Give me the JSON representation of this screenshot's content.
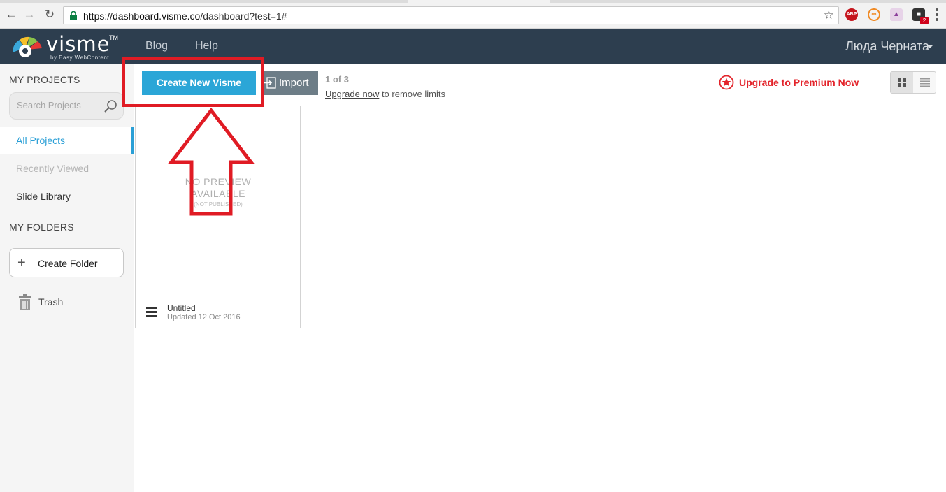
{
  "browser": {
    "url_host": "https://dashboard.visme.co",
    "url_path": "/dashboard?test=1#",
    "ext_abp_label": "ABP",
    "ext_badge": "2"
  },
  "header": {
    "logo_word": "visme",
    "logo_tm": "TM",
    "logo_sub": "by Easy WebContent",
    "links": [
      "Blog",
      "Help"
    ],
    "user_name": "Люда Черната"
  },
  "sidebar": {
    "projects_title": "MY PROJECTS",
    "search_placeholder": "Search Projects",
    "nav": [
      {
        "label": "All Projects",
        "state": "active"
      },
      {
        "label": "Recently Viewed",
        "state": "disabled"
      },
      {
        "label": "Slide Library",
        "state": "normal"
      }
    ],
    "folders_title": "MY FOLDERS",
    "create_folder_label": "Create Folder",
    "trash_label": "Trash"
  },
  "toolbar": {
    "create_label": "Create New Visme",
    "import_label": "Import",
    "quota_text": "1 of 3",
    "upgrade_link": "Upgrade now",
    "upgrade_rest": " to remove limits",
    "premium_label": "Upgrade to Premium Now"
  },
  "projects": [
    {
      "title": "Untitled",
      "updated": "Updated 12 Oct 2016",
      "preview_line1": "NO PREVIEW",
      "preview_line2": "AVAILABLE",
      "preview_note": "(NOT PUBLISHED)"
    }
  ],
  "colors": {
    "header_bg": "#2d3e4f",
    "accent_blue": "#2ba6d7",
    "premium_red": "#e3242b",
    "annotation_red": "#e01b24"
  }
}
